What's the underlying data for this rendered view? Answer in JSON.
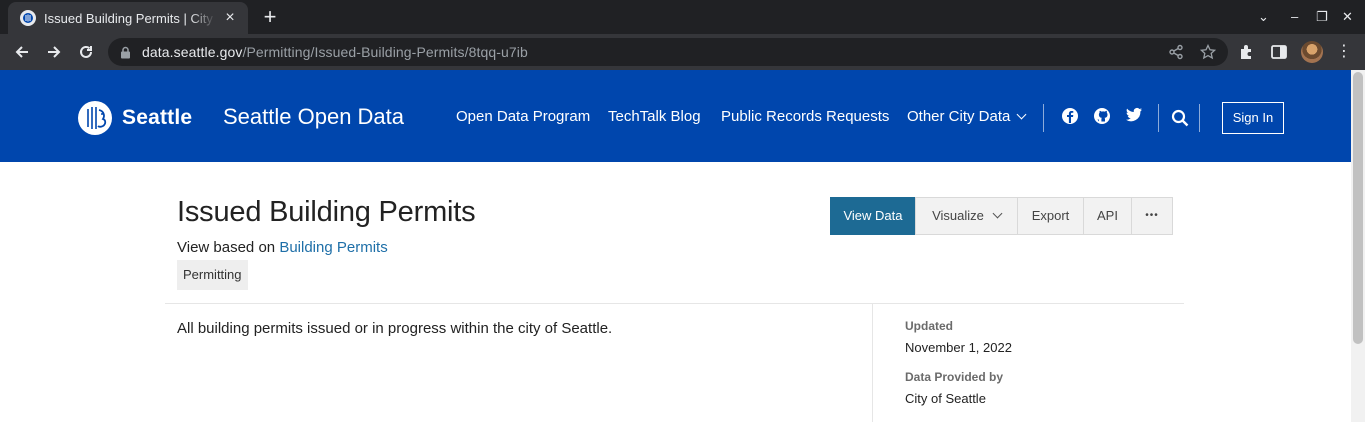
{
  "browser": {
    "tab_title": "Issued Building Permits | City of Seattle Open Data portal",
    "new_tab": "+",
    "url_domain": "data.seattle.gov",
    "url_path": "/Permitting/Issued-Building-Permits/8tqq-u7ib",
    "window_controls": {
      "dropdown": "⌄",
      "minimize": "–",
      "restore": "❐",
      "close": "✕"
    },
    "kebab": "⋮"
  },
  "site_header": {
    "logo_text": "Seattle",
    "site_title": "Seattle Open Data",
    "nav": [
      {
        "label": "Open Data Program"
      },
      {
        "label": "TechTalk Blog"
      },
      {
        "label": "Public Records Requests"
      },
      {
        "label": "Other City Data"
      }
    ],
    "social_icons": [
      "facebook-icon",
      "github-icon",
      "twitter-icon"
    ],
    "sign_in": "Sign In",
    "background": "#0046ad"
  },
  "dataset": {
    "title": "Issued Building Permits",
    "based_on_prefix": "View based on ",
    "based_on_link": "Building Permits",
    "tag": "Permitting",
    "description": "All building permits issued or in progress within the city of Seattle."
  },
  "actions": {
    "view_data": "View Data",
    "visualize": "Visualize",
    "export": "Export",
    "api": "API",
    "more": "•••",
    "primary_color": "#1d6a94"
  },
  "metadata": {
    "updated_label": "Updated",
    "updated_value": "November 1, 2022",
    "provided_label": "Data Provided by",
    "provided_value": "City of Seattle"
  }
}
